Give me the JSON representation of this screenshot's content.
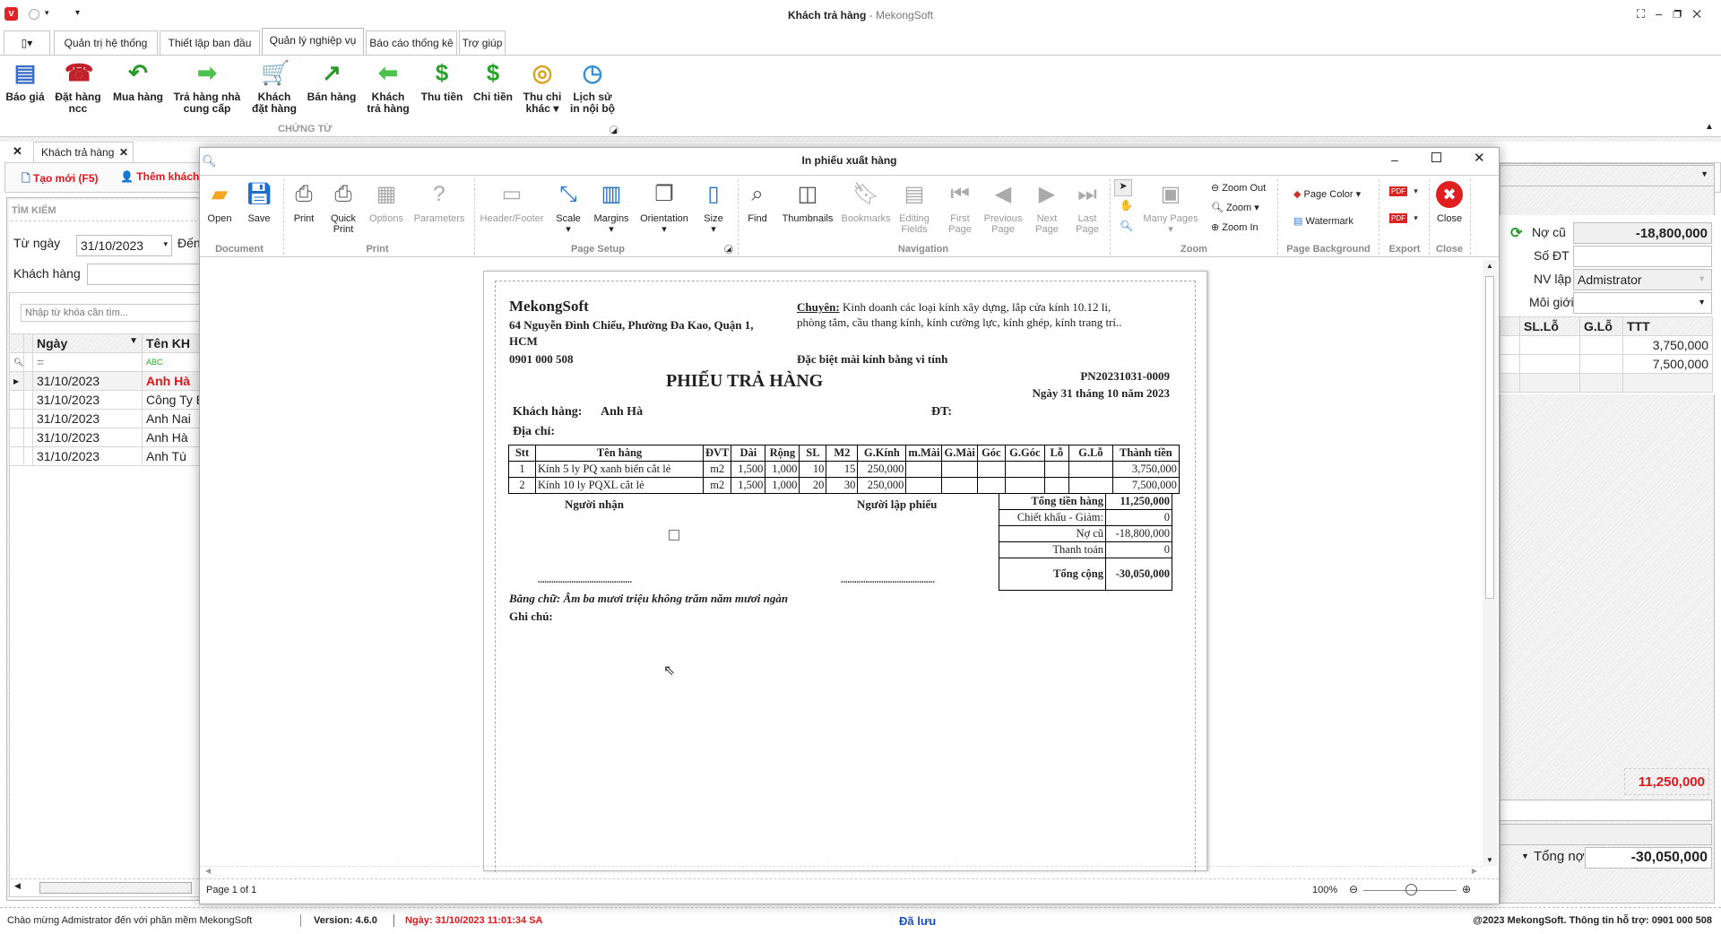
{
  "app": {
    "title": "Khách trả hàng",
    "title_suffix": " - MekongSoft"
  },
  "main_tabs": [
    "Quản trị hệ thống",
    "Thiết lập ban đầu",
    "Quản lý nghiệp vụ",
    "Báo cáo thống kê",
    "Trợ giúp"
  ],
  "ribbon": {
    "group_label": "CHỨNG TỪ",
    "buttons": [
      {
        "l1": "Báo giá",
        "l2": "",
        "icon": "quote-list-icon"
      },
      {
        "l1": "Đặt hàng",
        "l2": "ncc",
        "icon": "telephone-icon"
      },
      {
        "l1": "Mua hàng",
        "l2": "",
        "icon": "arrow-back-icon"
      },
      {
        "l1": "Trả hàng nhà",
        "l2": "cung cấp",
        "icon": "arrow-right-icon"
      },
      {
        "l1": "Khách",
        "l2": "đặt hàng",
        "icon": "shopping-cart-icon"
      },
      {
        "l1": "Bán hàng",
        "l2": "",
        "icon": "arrow-up-right-icon"
      },
      {
        "l1": "Khách",
        "l2": "trả hàng",
        "icon": "arrow-left-icon"
      },
      {
        "l1": "Thu tiền",
        "l2": "",
        "icon": "dollar-plus-icon"
      },
      {
        "l1": "Chi tiền",
        "l2": "",
        "icon": "dollar-minus-icon"
      },
      {
        "l1": "Thu chi",
        "l2": "khác ▾",
        "icon": "coins-icon"
      },
      {
        "l1": "Lịch sử",
        "l2": "in nội bộ",
        "icon": "history-icon"
      }
    ]
  },
  "doc_tab": {
    "label": "Khách trả hàng"
  },
  "toolbar": {
    "new": "Tạo mới (F5)",
    "add_customer": "Thêm khách"
  },
  "search": {
    "title": "TÌM KIẾM",
    "from_label": "Từ ngày",
    "from_value": "31/10/2023",
    "to_label": "Đến",
    "customer_label": "Khách hàng",
    "keyword_placeholder": "Nhập từ khóa cần tìm...",
    "columns": [
      "Ngày",
      "Tên KH"
    ],
    "rows": [
      [
        "31/10/2023",
        "Anh Hà"
      ],
      [
        "31/10/2023",
        "Công Ty Bì"
      ],
      [
        "31/10/2023",
        "Anh Nai"
      ],
      [
        "31/10/2023",
        "Anh Hà"
      ],
      [
        "31/10/2023",
        "Anh Tú"
      ]
    ]
  },
  "dialog": {
    "title": "In phiếu xuất hàng",
    "buttons": [
      {
        "l1": "Open",
        "l2": "",
        "icon": "folder-open-icon",
        "dis": false,
        "color": "#f5a623"
      },
      {
        "l1": "Save",
        "l2": "",
        "icon": "save-icon",
        "dis": false,
        "color": "#1f6fd1"
      },
      {
        "l1": "Print",
        "l2": "",
        "icon": "printer-icon",
        "dis": false,
        "color": "#555"
      },
      {
        "l1": "Quick",
        "l2": "Print",
        "icon": "quick-print-icon",
        "dis": false,
        "color": "#555"
      },
      {
        "l1": "Options",
        "l2": "",
        "icon": "options-icon",
        "dis": true,
        "color": "#aaa"
      },
      {
        "l1": "Parameters",
        "l2": "",
        "icon": "parameters-icon",
        "dis": true,
        "color": "#aaa"
      },
      {
        "l1": "Header/Footer",
        "l2": "",
        "icon": "header-footer-icon",
        "dis": true,
        "color": "#aaa"
      },
      {
        "l1": "Scale",
        "l2": "▾",
        "icon": "scale-icon",
        "dis": false,
        "color": "#1f6fd1"
      },
      {
        "l1": "Margins",
        "l2": "▾",
        "icon": "margins-icon",
        "dis": false,
        "color": "#1f6fd1"
      },
      {
        "l1": "Orientation",
        "l2": "▾",
        "icon": "orientation-icon",
        "dis": false,
        "color": "#555"
      },
      {
        "l1": "Size",
        "l2": "▾",
        "icon": "page-size-icon",
        "dis": false,
        "color": "#1f6fd1"
      },
      {
        "l1": "Find",
        "l2": "",
        "icon": "binoculars-icon",
        "dis": false,
        "color": "#555"
      },
      {
        "l1": "Thumbnails",
        "l2": "",
        "icon": "thumbnails-icon",
        "dis": false,
        "color": "#555"
      },
      {
        "l1": "Bookmarks",
        "l2": "",
        "icon": "bookmark-icon",
        "dis": true,
        "color": "#aaa"
      },
      {
        "l1": "Editing",
        "l2": "Fields",
        "icon": "editing-fields-icon",
        "dis": true,
        "color": "#aaa"
      },
      {
        "l1": "First",
        "l2": "Page",
        "icon": "first-page-icon",
        "dis": true,
        "color": "#aaa"
      },
      {
        "l1": "Previous",
        "l2": "Page",
        "icon": "previous-page-icon",
        "dis": true,
        "color": "#aaa"
      },
      {
        "l1": "Next",
        "l2": "Page",
        "icon": "next-page-icon",
        "dis": true,
        "color": "#aaa"
      },
      {
        "l1": "Last",
        "l2": "Page",
        "icon": "last-page-icon",
        "dis": true,
        "color": "#aaa"
      },
      {
        "l1": "Many Pages",
        "l2": "▾",
        "icon": "many-pages-icon",
        "dis": true,
        "color": "#aaa"
      },
      {
        "l1": "Close",
        "l2": "",
        "icon": "close-circle-icon",
        "dis": false,
        "color": "#e02020"
      }
    ],
    "zoom_out": "Zoom Out",
    "zoom": "Zoom ▾",
    "zoom_in": "Zoom In",
    "page_color": "Page Color ▾",
    "watermark": "Watermark",
    "groups": [
      "Document",
      "Print",
      "Page Setup",
      "Navigation",
      "Zoom",
      "Page Background",
      "Export",
      "Close"
    ],
    "page_status": "Page 1 of 1",
    "zoom_level": "100%"
  },
  "receipt": {
    "company": "MekongSoft",
    "address1": "64 Nguyễn Đình Chiểu, Phường Đa Kao, Quận 1,",
    "address2": "HCM",
    "phone": "0901 000 508",
    "spec_label": "Chuyên:",
    "spec1": " Kinh doanh các loại kính xây dựng, lắp cửa kính 10.12 li,",
    "spec2": "phòng tắm, cầu thang kính, kính cường lực, kính ghép, kính trang trí..",
    "special": "Đặc biệt mài kính bằng vi tính",
    "title": "PHIẾU TRẢ HÀNG",
    "code": "PN20231031-0009",
    "date": "Ngày 31 tháng 10 năm 2023",
    "customer_label": "Khách hàng:",
    "customer": "Anh Hà",
    "phone_label": "ĐT:",
    "address_label": "Địa chỉ:",
    "columns": [
      "Stt",
      "Tên hàng",
      "ĐVT",
      "Dài",
      "Rộng",
      "SL",
      "M2",
      "G.Kính",
      "m.Mài",
      "G.Mài",
      "Góc",
      "G.Góc",
      "Lỗ",
      "G.Lỗ",
      "Thành tiền"
    ],
    "rows": [
      [
        "1",
        "Kính 5 ly PQ xanh biển cắt lẻ",
        "m2",
        "1,500",
        "1,000",
        "10",
        "15",
        "250,000",
        "",
        "",
        "",
        "",
        "",
        "",
        "3,750,000"
      ],
      [
        "2",
        "Kính 10 ly PQXL cắt lẻ",
        "m2",
        "1,500",
        "1,000",
        "20",
        "30",
        "250,000",
        "",
        "",
        "",
        "",
        "",
        "",
        "7,500,000"
      ]
    ],
    "totals": [
      [
        "Tổng tiền hàng",
        "11,250,000"
      ],
      [
        "Chiết khấu - Giảm:",
        "0"
      ],
      [
        "Nợ cũ",
        "-18,800,000"
      ],
      [
        "Thanh toán",
        "0"
      ],
      [
        "Tổng cộng",
        "-30,050,000"
      ]
    ],
    "receiver": "Người nhận",
    "creator": "Người lập phiếu",
    "dots": "..........................................",
    "in_words": "Bằng chữ: Âm ba mươi triệu không trăm năm mươi ngàn",
    "note_label": "Ghi chú:"
  },
  "right_panel": {
    "old_debt_label": "Nợ cũ",
    "old_debt": "-18,800,000",
    "phone_label": "Số ĐT",
    "staff_label": "NV lập",
    "staff": "Admistrator",
    "broker_label": "Môi giới",
    "columns": [
      "SL.Lỗ",
      "G.Lỗ",
      "TTT"
    ],
    "rows": [
      "3,750,000",
      "7,500,000"
    ],
    "subtotal": "11,250,000",
    "total_debt_label": "Tổng nợ",
    "total_debt": "-30,050,000"
  },
  "status": {
    "welcome": "Chào mừng Admistrator đến với phần mềm MekongSoft",
    "version": "Version: 4.6.0",
    "date": "Ngày: 31/10/2023 11:01:34 SA",
    "saved": "Đã lưu",
    "copyright": "@2023 MekongSoft. Thông tin hỗ trợ: 0901 000 508"
  },
  "colors": {
    "accent_red": "#e8141b",
    "saved_blue": "#1a4fc4"
  }
}
